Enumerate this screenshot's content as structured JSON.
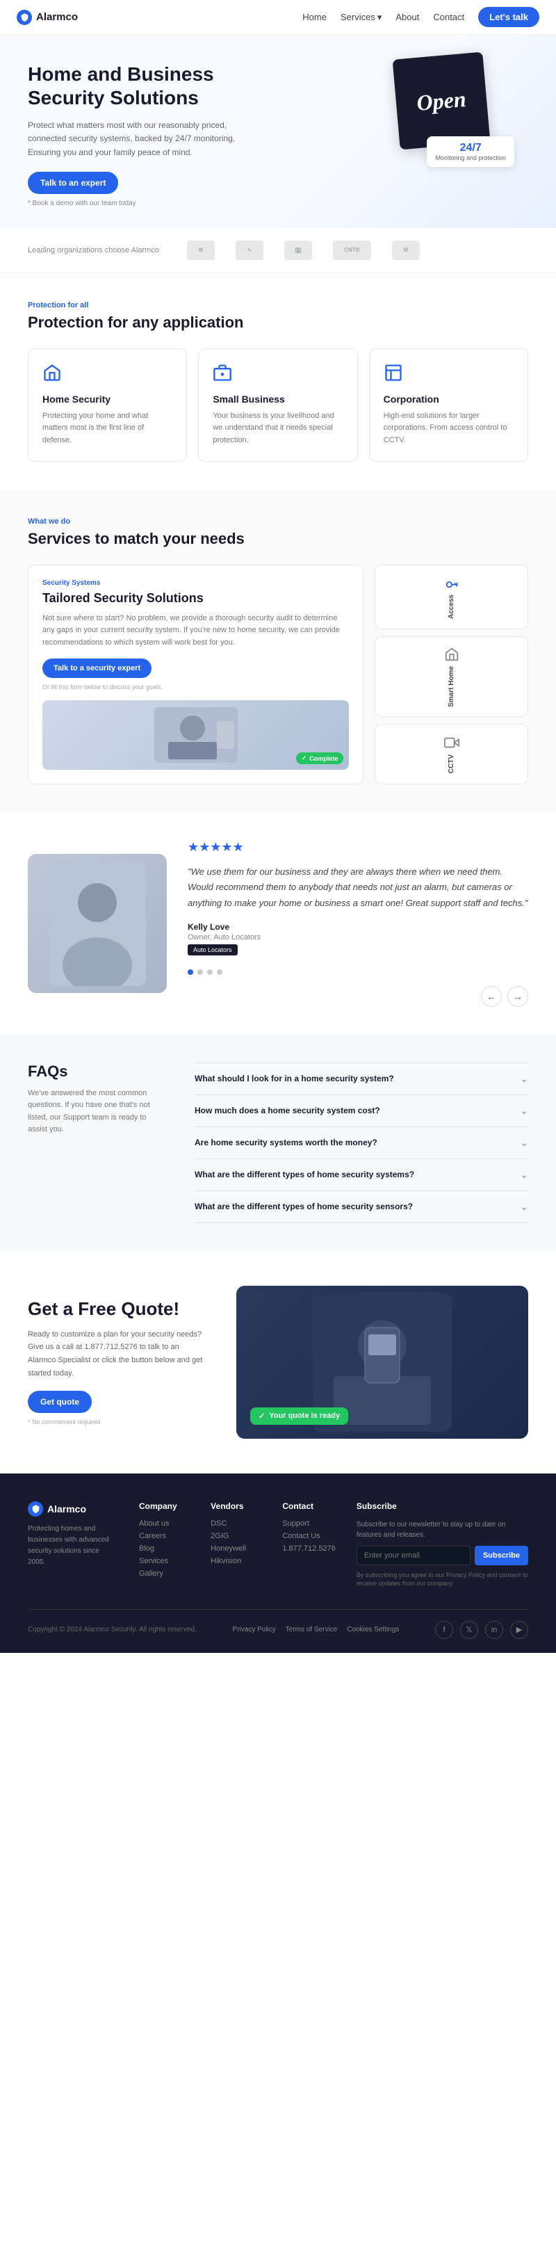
{
  "nav": {
    "logo": "Alarmco",
    "links": [
      "Home",
      "Services",
      "About",
      "Contact"
    ],
    "services_label": "Services",
    "cta_label": "Let's talk"
  },
  "hero": {
    "title": "Home and Business Security Solutions",
    "description": "Protect what matters most with our reasonably priced, connected security systems, backed by 24/7 monitoring. Ensuring you and your family peace of mind.",
    "cta_label": "Talk to an expert",
    "small_link": "* Book a demo with our team today",
    "badge_main": "24/7",
    "badge_sub": "Monitoring and protection",
    "open_sign": "Open"
  },
  "logos": {
    "label": "Leading organizations choose Alarmco"
  },
  "protection": {
    "section_label": "Protection for all",
    "title": "Protection for any application",
    "cards": [
      {
        "title": "Home Security",
        "description": "Protecting your home and what matters most is the first line of defense."
      },
      {
        "title": "Small Business",
        "description": "Your business is your livelihood and we understand that it needs special protection."
      },
      {
        "title": "Corporation",
        "description": "High-end solutions for larger corporations. From access control to CCTV."
      }
    ]
  },
  "services": {
    "section_label": "What we do",
    "title": "Services to match your needs",
    "main": {
      "sub_label": "Security Systems",
      "title": "Tailored Security Solutions",
      "description": "Not sure where to start? No problem, we provide a thorough security audit to determine any gaps in your current security system. If you're new to home security, we can provide recommendations to which system will work best for you.",
      "cta_label": "Talk to a security expert",
      "note": "Or fill this form below to discuss your goals.",
      "complete_badge": "Complete"
    },
    "tabs": [
      {
        "label": "Access",
        "icon": "key-icon"
      },
      {
        "label": "Smart Home",
        "icon": "home-icon"
      },
      {
        "label": "CCTV",
        "icon": "camera-icon"
      }
    ]
  },
  "testimonial": {
    "stars": "★★★★★",
    "text": "\"We use them for our business and they are always there when we need them. Would recommend them to anybody that needs not just an alarm, but cameras or anything to make your home or business a smart one! Great support staff and techs.\"",
    "author": "Kelly Love",
    "author_title": "Owner, Auto Locators",
    "company": "Auto Locators",
    "dots": [
      true,
      false,
      false,
      false
    ],
    "prev_label": "←",
    "next_label": "→"
  },
  "faq": {
    "title": "FAQs",
    "description": "We've answered the most common questions. If you have one that's not listed, our Support team is ready to assist you.",
    "items": [
      {
        "question": "What should I look for in a home security system?"
      },
      {
        "question": "How much does a home security system cost?"
      },
      {
        "question": "Are home security systems worth the money?"
      },
      {
        "question": "What are the different types of home security systems?"
      },
      {
        "question": "What are the different types of home security sensors?"
      }
    ]
  },
  "quote": {
    "title": "Get a Free Quote!",
    "description": "Ready to customize a plan for your security needs? Give us a call at 1.877.712.5276 to talk to an Alarmco Specialist or click the button below and get started today.",
    "cta_label": "Get quote",
    "small": "* No commitment required",
    "badge": "Your quote is ready"
  },
  "footer": {
    "brand": "Alarmco",
    "brand_desc": "Protecting homes and businesses with advanced security solutions since 2005.",
    "cols": [
      {
        "title": "Company",
        "links": [
          "About us",
          "Careers",
          "Blog",
          "Services",
          "Gallery"
        ]
      },
      {
        "title": "Vendors",
        "links": [
          "DSC",
          "2GIG",
          "Honeywell",
          "Hikvision"
        ]
      },
      {
        "title": "Contact",
        "links": [
          "Support",
          "Contact Us",
          "1.877.712.5276"
        ]
      }
    ],
    "subscribe": {
      "title": "Subscribe",
      "description": "Subscribe to our newsletter to stay up to date on features and releases.",
      "placeholder": "Enter your email",
      "btn_label": "Subscribe",
      "privacy": "By subscribing you agree to our Privacy Policy and consent to receive updates from our company."
    },
    "social_icons": [
      "f",
      "𝕏",
      "in",
      "▶"
    ],
    "copyright": "Copyright © 2024 Alarmco Security. All rights reserved.",
    "legal_links": [
      "Privacy Policy",
      "Terms of Service",
      "Cookies Settings"
    ]
  }
}
